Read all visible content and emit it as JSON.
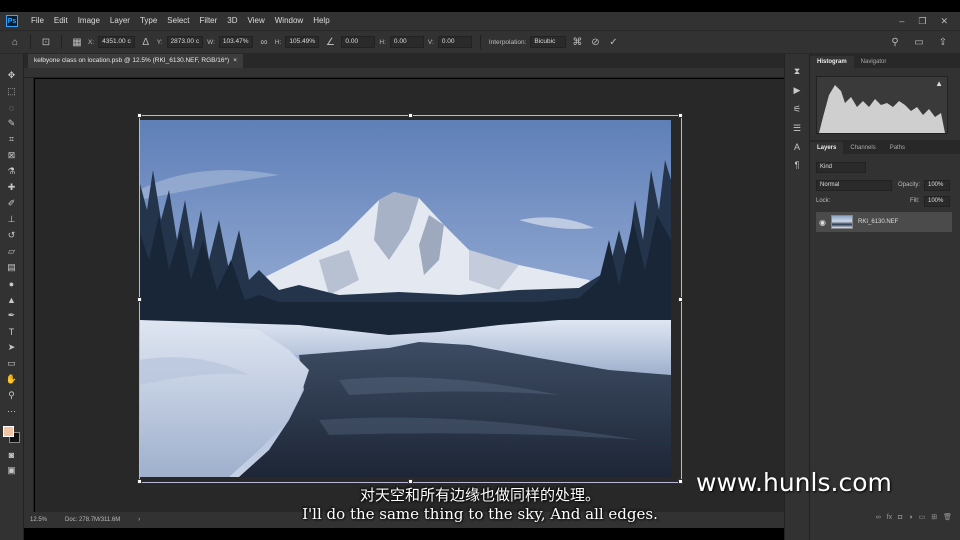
{
  "menu": {
    "items": [
      "File",
      "Edit",
      "Image",
      "Layer",
      "Type",
      "Select",
      "Filter",
      "3D",
      "View",
      "Window",
      "Help"
    ]
  },
  "options": {
    "x_label": "X:",
    "x_value": "4351.00 c",
    "y_label": "Y:",
    "y_value": "2873.00 c",
    "w_label": "W:",
    "w_value": "103.47%",
    "h_label": "H:",
    "h_value": "105.49%",
    "angle_value": "0.00",
    "hskew_label": "H:",
    "hskew_value": "0.00",
    "vskew_label": "V:",
    "vskew_value": "0.00",
    "interp_label": "Interpolation:",
    "interp_value": "Bicubic"
  },
  "document": {
    "tab_title": "kelbyone class on location.psb @ 12.5% (RKI_6130.NEF, RGB/16*)",
    "tab_close": "×"
  },
  "status": {
    "zoom": "12.5%",
    "doc_info": "Doc: 278.7M/311.6M",
    "arrow": "›"
  },
  "panels": {
    "top_tabs": [
      "Histogram",
      "Navigator"
    ],
    "layer_tabs": [
      "Layers",
      "Channels",
      "Paths"
    ],
    "kind_placeholder": "Kind",
    "blend_mode": "Normal",
    "opacity_label": "Opacity:",
    "opacity_value": "100%",
    "lock_label": "Lock:",
    "fill_label": "Fill:",
    "fill_value": "100%",
    "layer_name": "RKI_6130.NEF"
  },
  "subtitles": {
    "chinese": "对天空和所有边缘也做同样的处理。",
    "english": "I'll do the same thing to the sky, And all edges."
  },
  "watermark": "www.hunls.com",
  "colors": {
    "foreground": "#f2c6a4",
    "background": "#111111",
    "accent": "#31a8ff"
  }
}
